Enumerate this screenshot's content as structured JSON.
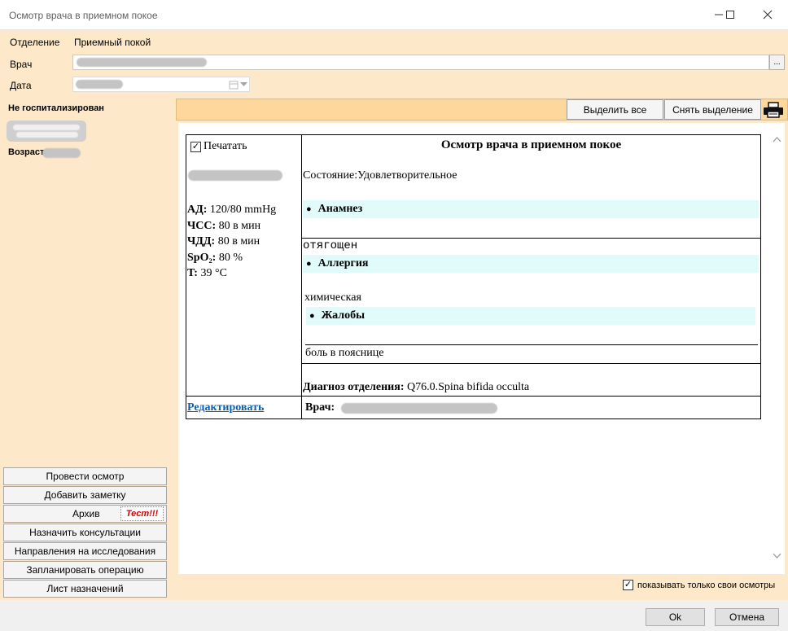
{
  "window": {
    "title": "Осмотр врача в приемном покое"
  },
  "form": {
    "department_label": "Отделение",
    "department_value": "Приемный покой",
    "doctor_label": "Врач",
    "doctor_browse_label": "...",
    "date_label": "Дата"
  },
  "patient": {
    "status": "Не госпитализирован",
    "age_label": "Возраст"
  },
  "toolbar": {
    "select_all": "Выделить все",
    "deselect": "Снять выделение"
  },
  "report": {
    "print_label": "Печатать",
    "print_checked": true,
    "vitals": [
      {
        "label": "АД:",
        "value": "120/80 mmHg"
      },
      {
        "label": "ЧСС:",
        "value": "80 в мин"
      },
      {
        "label": "ЧДД:",
        "value": "80 в мин"
      },
      {
        "label": "SpO₂:",
        "value": "80 %"
      },
      {
        "label": "T:",
        "value": "39 °С"
      }
    ],
    "title": "Осмотр врача в приемном покое",
    "condition": "Состояние:Удовлетворительное",
    "anamnesis_heading": "Анамнез",
    "anamnesis_text": "отягощен",
    "allergy_heading": "Аллергия",
    "allergy_text": "химическая",
    "complaints_heading": "Жалобы",
    "complaints_text": "боль в пояснице",
    "diagnosis_label": "Диагноз отделения:",
    "diagnosis_value": "Q76.0.Spina bifida occulta",
    "edit_link": "Редактировать",
    "doctor_label": "Врач:"
  },
  "sidebar_buttons": [
    "Провести осмотр",
    "Добавить заметку",
    "Архив",
    "Назначить консультации",
    "Направления на исследования",
    "Запланировать операцию",
    "Лист назначений"
  ],
  "test_badge": "Тест!!!",
  "options": {
    "only_own_label": "показывать только свои осмотры",
    "only_own_checked": true
  },
  "dialog": {
    "ok": "Ok",
    "cancel": "Отмена"
  },
  "colors": {
    "panel_bg": "#fde9c9",
    "toolbar_bg": "#fdd79c",
    "band_bg": "#e1fbfb",
    "link": "#0b5fb3",
    "badge_text": "#d40000"
  }
}
